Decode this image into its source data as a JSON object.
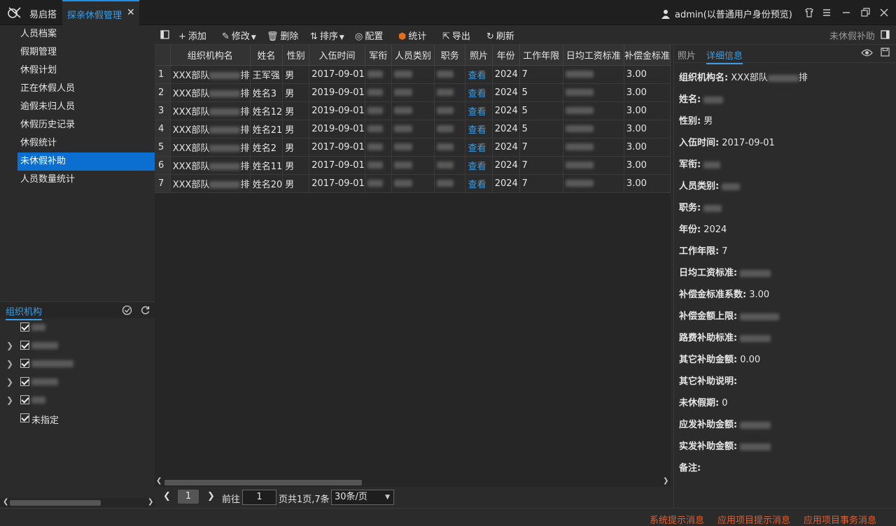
{
  "app": {
    "name": "易启搭",
    "active_tab": "探亲休假管理",
    "user": "admin(以普通用户身份预览)"
  },
  "sidebar": {
    "items": [
      "人员档案",
      "假期管理",
      "休假计划",
      "正在休假人员",
      "逾假未归人员",
      "休假历史记录",
      "休假统计",
      "未休假补助",
      "人员数量统计"
    ],
    "selected_index": 7
  },
  "org": {
    "title": "组织机构",
    "nodes": [
      {
        "label": "",
        "expandable": false,
        "checked": true
      },
      {
        "label": "",
        "expandable": true,
        "checked": true
      },
      {
        "label": "",
        "expandable": true,
        "checked": true
      },
      {
        "label": "",
        "expandable": true,
        "checked": true
      },
      {
        "label": "",
        "expandable": true,
        "checked": true
      },
      {
        "label": "未指定",
        "expandable": false,
        "checked": true
      }
    ]
  },
  "toolbar": {
    "add": "添加",
    "edit": "修改",
    "delete": "删除",
    "sort": "排序",
    "config": "配置",
    "stats": "统计",
    "export": "导出",
    "refresh": "刷新",
    "view_name": "未休假补助"
  },
  "table": {
    "columns": [
      "组织机构名",
      "姓名",
      "性别",
      "入伍时间",
      "军衔",
      "人员类别",
      "职务",
      "照片",
      "年份",
      "工作年限",
      "日均工资标准",
      "补偿金标准"
    ],
    "rows": [
      [
        "1",
        "XXX部队",
        "王军强",
        "男",
        "2017-09-01",
        "",
        "",
        "",
        "查看",
        "2024",
        "7",
        "",
        "3.00"
      ],
      [
        "2",
        "XXX部队",
        "姓名3",
        "男",
        "2019-09-01",
        "",
        "",
        "",
        "查看",
        "2024",
        "5",
        "",
        "3.00"
      ],
      [
        "3",
        "XXX部队",
        "姓名12",
        "男",
        "2019-09-01",
        "",
        "",
        "",
        "查看",
        "2024",
        "5",
        "",
        "3.00"
      ],
      [
        "4",
        "XXX部队",
        "姓名21",
        "男",
        "2019-09-01",
        "",
        "",
        "",
        "查看",
        "2024",
        "5",
        "",
        "3.00"
      ],
      [
        "5",
        "XXX部队",
        "姓名2",
        "男",
        "2017-09-01",
        "",
        "",
        "",
        "查看",
        "2024",
        "7",
        "",
        "3.00"
      ],
      [
        "6",
        "XXX部队",
        "姓名11",
        "男",
        "2017-09-01",
        "",
        "",
        "",
        "查看",
        "2024",
        "7",
        "",
        "3.00"
      ],
      [
        "7",
        "XXX部队",
        "姓名20",
        "男",
        "2017-09-01",
        "",
        "",
        "",
        "查看",
        "2024",
        "7",
        "",
        "3.00"
      ]
    ],
    "org_suffix": "排"
  },
  "pager": {
    "current": "1",
    "goto_label": "前往",
    "goto_value": "1",
    "summary": "页共1页,7条",
    "page_size": "30条/页"
  },
  "detail": {
    "tabs": [
      "照片",
      "详细信息"
    ],
    "fields": [
      {
        "label": "组织机构名:",
        "value": "XXX部队"
      },
      {
        "label": "姓名:",
        "value": ""
      },
      {
        "label": "性别:",
        "value": "男"
      },
      {
        "label": "入伍时间:",
        "value": "2017-09-01"
      },
      {
        "label": "军衔:",
        "value": ""
      },
      {
        "label": "人员类别:",
        "value": ""
      },
      {
        "label": "职务:",
        "value": ""
      },
      {
        "label": "年份:",
        "value": "2024"
      },
      {
        "label": "工作年限:",
        "value": "7"
      },
      {
        "label": "日均工资标准:",
        "value": ""
      },
      {
        "label": "补偿金标准系数:",
        "value": "3.00"
      },
      {
        "label": "补偿金额上限:",
        "value": ""
      },
      {
        "label": "路费补助标准:",
        "value": ""
      },
      {
        "label": "其它补助金额:",
        "value": "0.00"
      },
      {
        "label": "其它补助说明:",
        "value": ""
      },
      {
        "label": "未休假期:",
        "value": "0"
      },
      {
        "label": "应发补助金额:",
        "value": ""
      },
      {
        "label": "实发补助金额:",
        "value": ""
      },
      {
        "label": "备注:",
        "value": ""
      }
    ]
  },
  "status": {
    "sys": "系统提示消息",
    "app_tip": "应用项目提示消息",
    "app_task": "应用项目事务消息"
  }
}
